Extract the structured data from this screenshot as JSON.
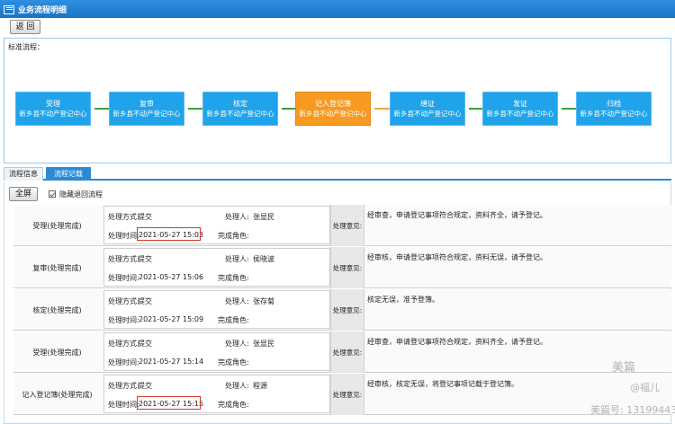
{
  "window": {
    "title": "业务流程明细"
  },
  "toolbar": {
    "back_label": "返 回"
  },
  "flow": {
    "label": "标准流程：",
    "steps": [
      {
        "name": "受理",
        "org": "新乡县不动产登记中心",
        "current": false
      },
      {
        "name": "复审",
        "org": "新乡县不动产登记中心",
        "current": false
      },
      {
        "name": "核定",
        "org": "新乡县不动产登记中心",
        "current": false
      },
      {
        "name": "记入登记簿",
        "org": "新乡县不动产登记中心",
        "current": true
      },
      {
        "name": "缮证",
        "org": "新乡县不动产登记中心",
        "current": false
      },
      {
        "name": "发证",
        "org": "新乡县不动产登记中心",
        "current": false
      },
      {
        "name": "归档",
        "org": "新乡县不动产登记中心",
        "current": false
      }
    ]
  },
  "tabs": [
    {
      "label": "流程信息",
      "active": false
    },
    {
      "label": "流程记载",
      "active": true
    }
  ],
  "controls": {
    "fullscreen_label": "全屏",
    "hide_return_label": "隐藏退回流程",
    "hide_return_checked": true
  },
  "labels": {
    "method": "处理方式:",
    "handler": "处理人:",
    "time": "处理时间:",
    "role": "完成角色:",
    "opinion": "处理意见:"
  },
  "records": [
    {
      "status": "受理(处理完成)",
      "method": "提交",
      "handler": "张显民",
      "time": "2021-05-27 15:03",
      "role": "",
      "opinion": "经审查，申请登记事项符合规定，资料齐全，请予登记。",
      "highlight": true
    },
    {
      "status": "复审(处理完成)",
      "method": "提交",
      "handler": "侯晓波",
      "time": "2021-05-27 15:06",
      "role": "",
      "opinion": "经审核，申请登记事项符合规定，资料无误，请予登记。",
      "highlight": false
    },
    {
      "status": "核定(处理完成)",
      "method": "提交",
      "handler": "张存菊",
      "time": "2021-05-27 15:09",
      "role": "",
      "opinion": "核定无误，准予登簿。",
      "highlight": false
    },
    {
      "status": "受理(处理完成)",
      "method": "提交",
      "handler": "张显民",
      "time": "2021-05-27 15:14",
      "role": "",
      "opinion": "经审查，申请登记事项符合规定，资料齐全，请予登记。",
      "highlight": false
    },
    {
      "status": "记入登记簿(处理完成)",
      "method": "提交",
      "handler": "程源",
      "time": "2021-05-27 15:15",
      "role": "",
      "opinion": "经审核，核定无误，将登记事项记载于登记簿。",
      "highlight": true
    }
  ],
  "watermark": {
    "brand": "美篇",
    "author": "@福儿",
    "id": "美篇号: 13199443"
  }
}
